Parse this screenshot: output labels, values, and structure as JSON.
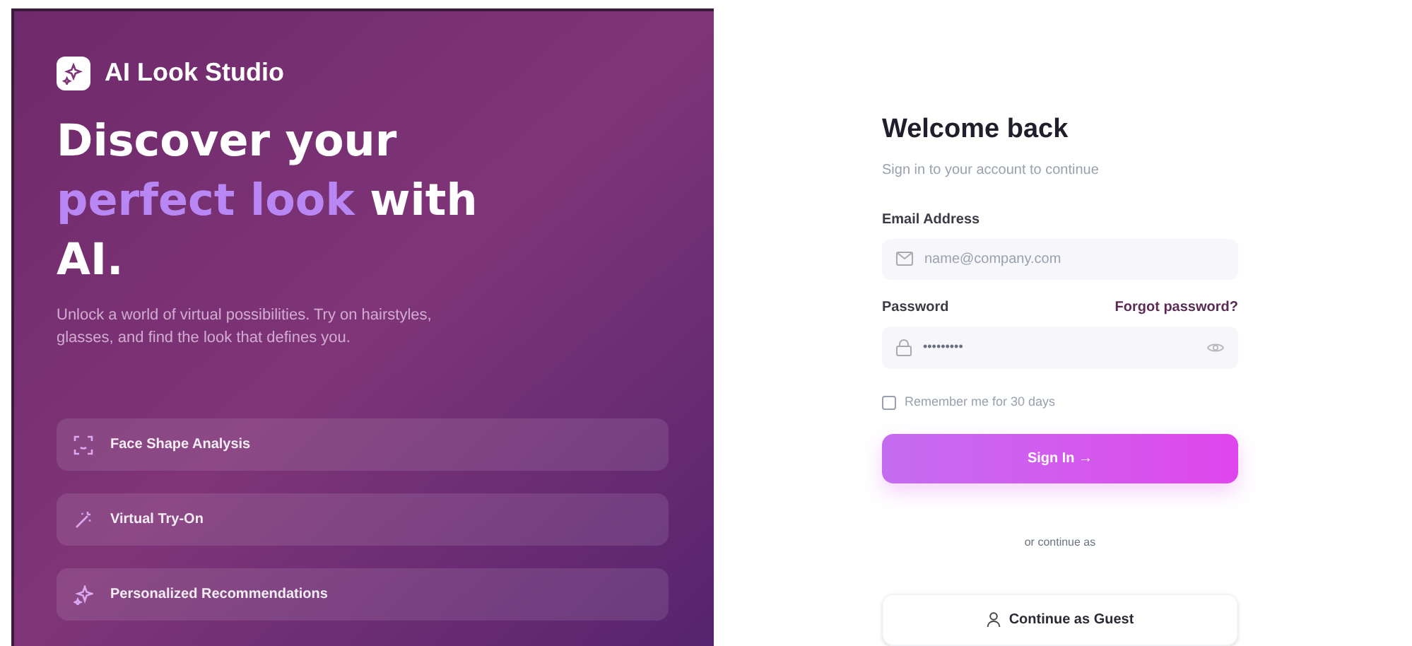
{
  "brand": {
    "name": "AI Look Studio"
  },
  "headline": [
    {
      "text": "Discover your ",
      "highlight": false
    },
    {
      "text": "perfect look",
      "highlight": true
    },
    {
      "text": " with AI.",
      "highlight": false
    }
  ],
  "description": "Unlock a world of virtual possibilities. Try on hairstyles, glasses, and find the look that defines you.",
  "features": [
    {
      "label": "Face Shape Analysis",
      "kind": "scan"
    },
    {
      "label": "Virtual Try-On",
      "kind": "wand"
    },
    {
      "label": "Personalized Recommendations",
      "kind": "sparkle"
    }
  ],
  "form": {
    "title": "Welcome back",
    "subtitle": "Sign in to your account to continue",
    "email": {
      "label": "Email Address",
      "placeholder": "name@company.com"
    },
    "password": {
      "label": "Password",
      "value": "•••••••••",
      "forgot": "Forgot password?"
    },
    "remember": {
      "label": "Remember me for 30 days",
      "checked": false
    },
    "submit": "Sign In →",
    "divider": "or continue as",
    "guest": "Continue as Guest"
  }
}
